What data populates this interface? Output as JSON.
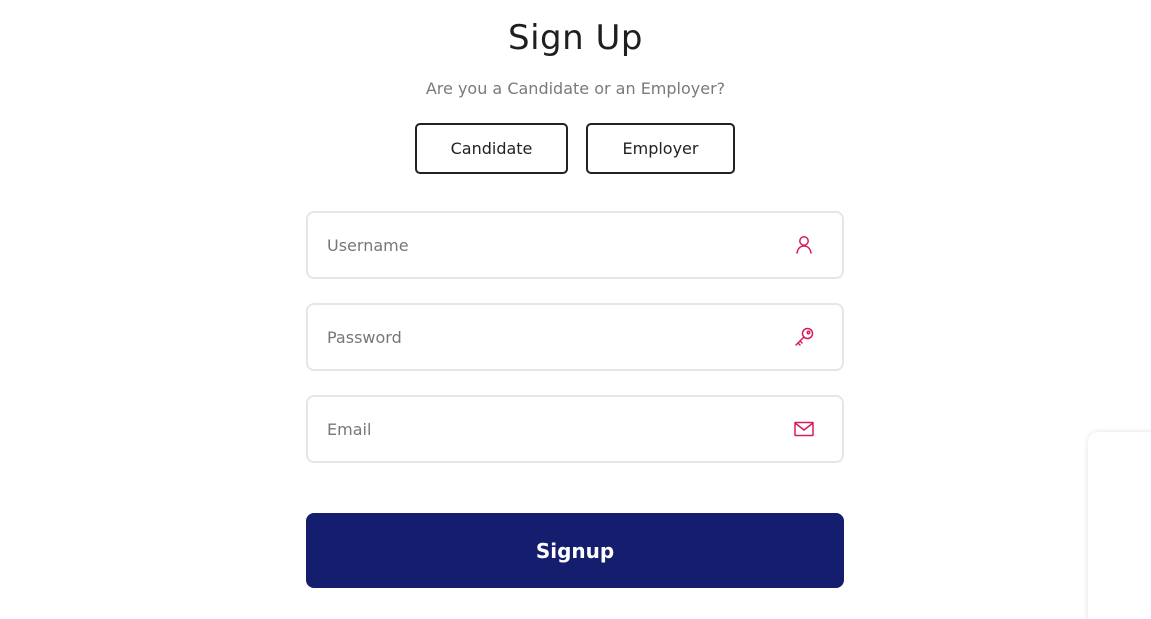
{
  "header": {
    "title": "Sign Up",
    "subtitle": "Are you a Candidate or an Employer?"
  },
  "roles": {
    "candidate_label": "Candidate",
    "employer_label": "Employer"
  },
  "form": {
    "username": {
      "value": "",
      "placeholder": "Username",
      "icon": "user-icon"
    },
    "password": {
      "value": "",
      "placeholder": "Password",
      "icon": "key-icon"
    },
    "email": {
      "value": "",
      "placeholder": "Email",
      "icon": "mail-icon"
    },
    "submit_label": "Signup"
  },
  "colors": {
    "accent_icon": "#d81b60",
    "primary_button": "#151e6e"
  }
}
